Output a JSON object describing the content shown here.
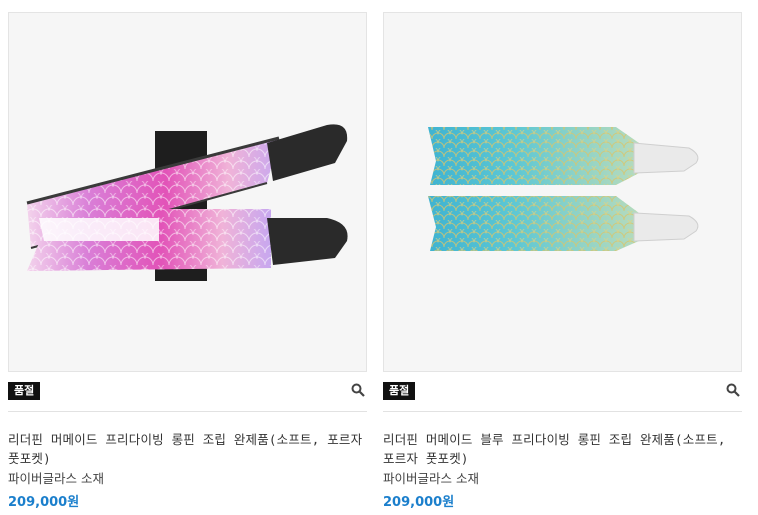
{
  "products": [
    {
      "badge": "품절",
      "name": "리더핀 머메이드 프리다이빙 롱핀 조립 완제품(소프트, 포르자 풋포켓)",
      "material": "파이버글라스 소재",
      "price": "209,000원",
      "theme": "pink-mermaid",
      "colors": {
        "blade_a": "#e86fc4",
        "blade_b": "#b47ee0",
        "foot": "#222222"
      }
    },
    {
      "badge": "품절",
      "name": "리더핀 머메이드 블루 프리다이빙 롱핀 조립 완제품(소프트, 포르자 풋포켓)",
      "material": "파이버글라스 소재",
      "price": "209,000원",
      "theme": "blue-mermaid",
      "colors": {
        "blade_a": "#35b7d6",
        "blade_b": "#9ad7c9",
        "foot": "#e9e9e9"
      }
    }
  ],
  "colors": {
    "accent": "#1b7fcc",
    "badge_bg": "#111111"
  },
  "icons": {
    "zoom": "magnifier-icon"
  }
}
